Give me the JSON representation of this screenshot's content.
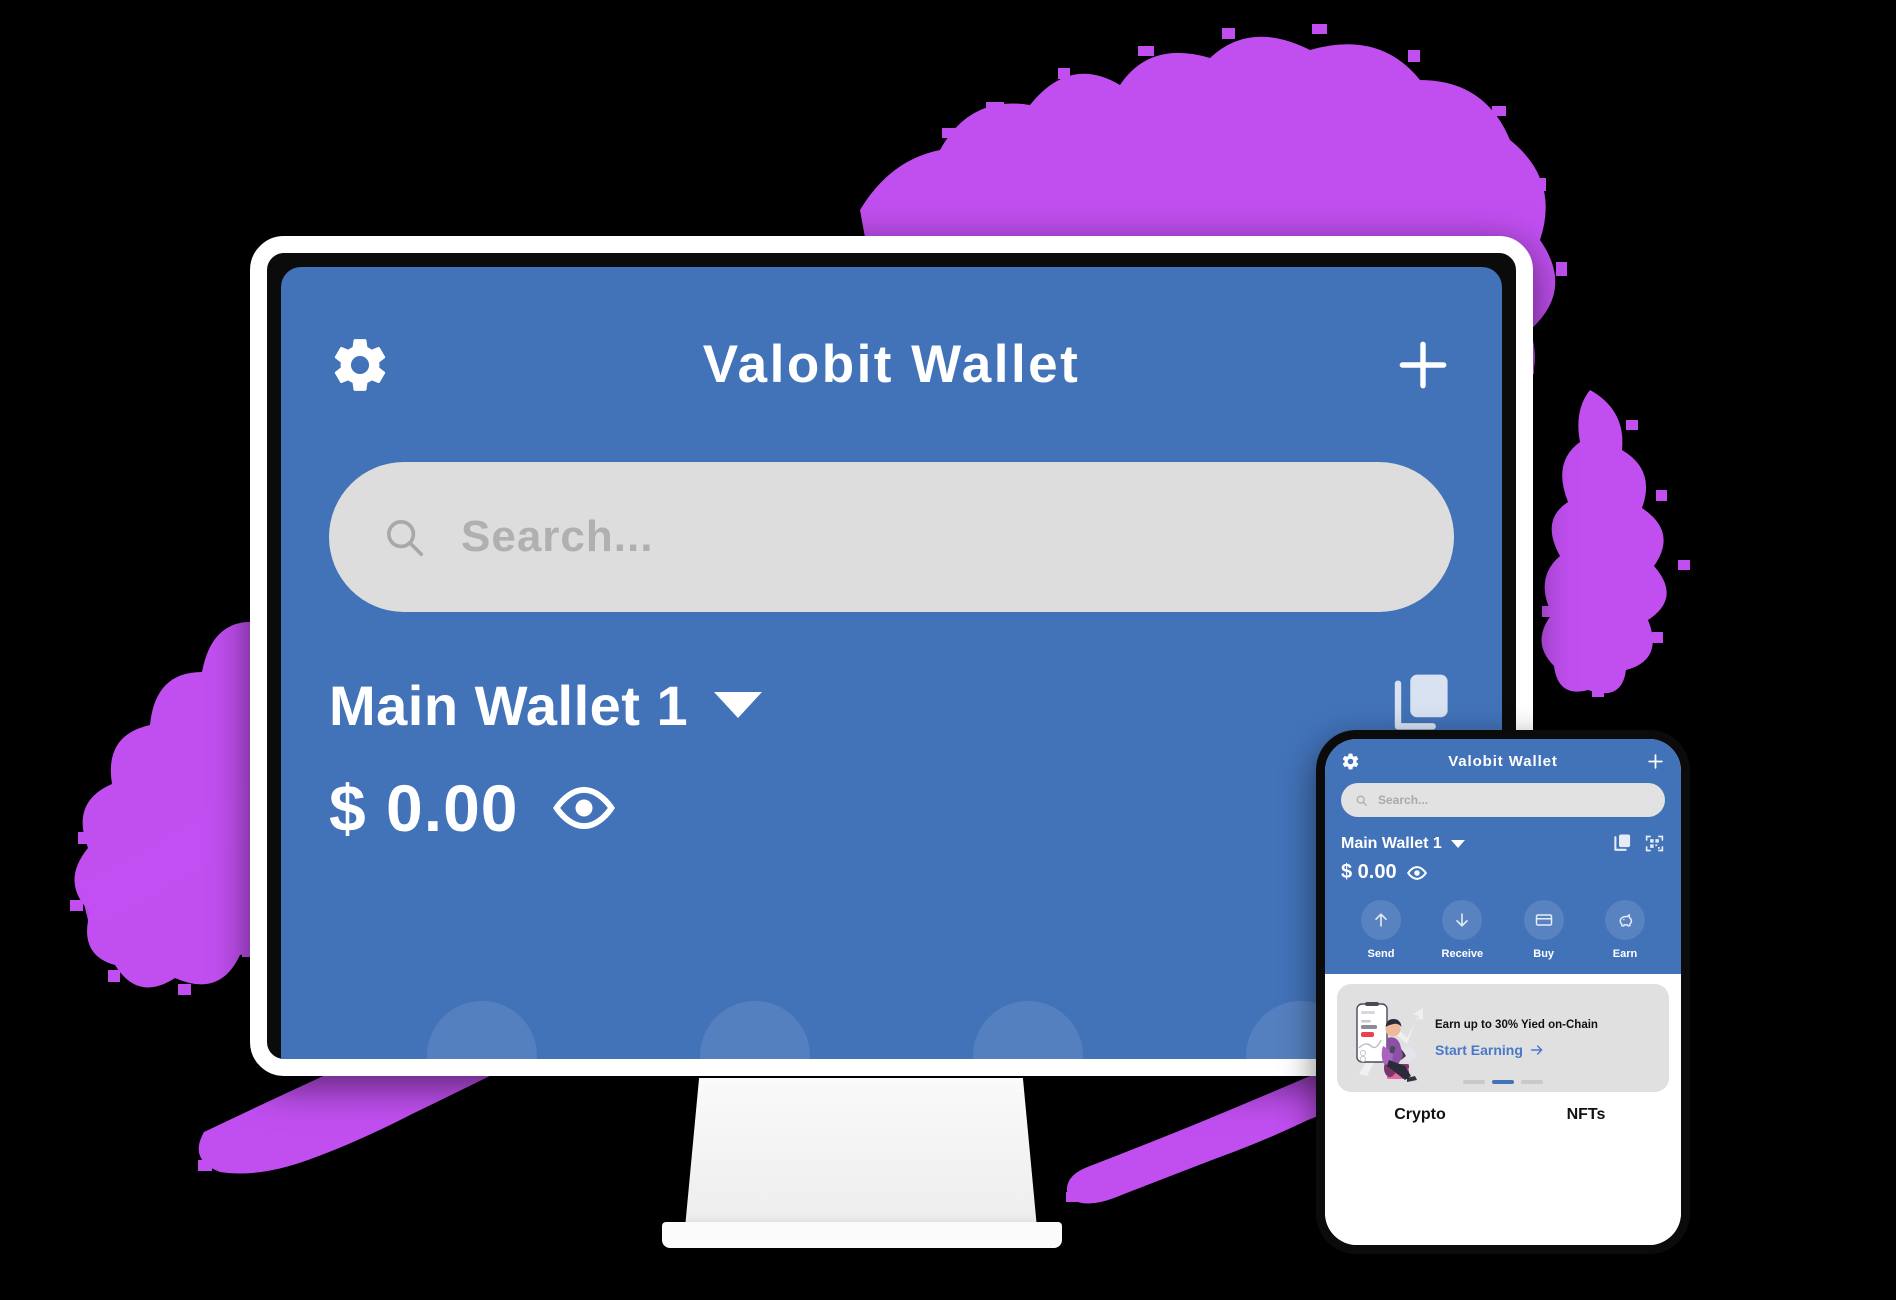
{
  "colors": {
    "brand_blue": "#4272B8",
    "splash_purple": "#C14FF0",
    "search_grey": "#DDDDDD",
    "promo_grey": "#E0E0E0",
    "cta_blue": "#4A78C8",
    "device_black": "#0B0B0B",
    "bezel_white": "#FFFFFF"
  },
  "desktop": {
    "header": {
      "settings_icon": "gear-icon",
      "title": "Valobit Wallet",
      "add_icon": "plus-icon"
    },
    "search": {
      "icon": "search-icon",
      "placeholder": "Search...",
      "value": ""
    },
    "wallet": {
      "name": "Main Wallet 1",
      "dropdown_icon": "chevron-down-icon",
      "copy_icon": "copy-icon"
    },
    "balance": {
      "currency_symbol": "$",
      "amount": "0.00",
      "display": "$ 0.00",
      "visibility_icon": "eye-icon"
    }
  },
  "phone": {
    "header": {
      "settings_icon": "gear-icon",
      "title": "Valobit Wallet",
      "add_icon": "plus-icon"
    },
    "search": {
      "icon": "search-icon",
      "placeholder": "Search...",
      "value": ""
    },
    "wallet": {
      "name": "Main Wallet 1",
      "dropdown_icon": "chevron-down-icon",
      "copy_icon": "copy-icon",
      "qr_icon": "qr-code-icon"
    },
    "balance": {
      "currency_symbol": "$",
      "amount": "0.00",
      "display": "$ 0.00",
      "visibility_icon": "eye-icon"
    },
    "actions": [
      {
        "label": "Send",
        "icon": "arrow-up-icon"
      },
      {
        "label": "Receive",
        "icon": "arrow-down-icon"
      },
      {
        "label": "Buy",
        "icon": "credit-card-icon"
      },
      {
        "label": "Earn",
        "icon": "piggy-bank-icon"
      }
    ],
    "promo": {
      "title": "Earn up to 30% Yied on-Chain",
      "cta_label": "Start Earning",
      "cta_icon": "arrow-right-icon",
      "illustration": "person-with-phone-chart-illustration",
      "carousel": {
        "total": 3,
        "active_index": 1
      }
    },
    "tabs": [
      {
        "label": "Crypto",
        "active": true
      },
      {
        "label": "NFTs",
        "active": false
      }
    ]
  }
}
